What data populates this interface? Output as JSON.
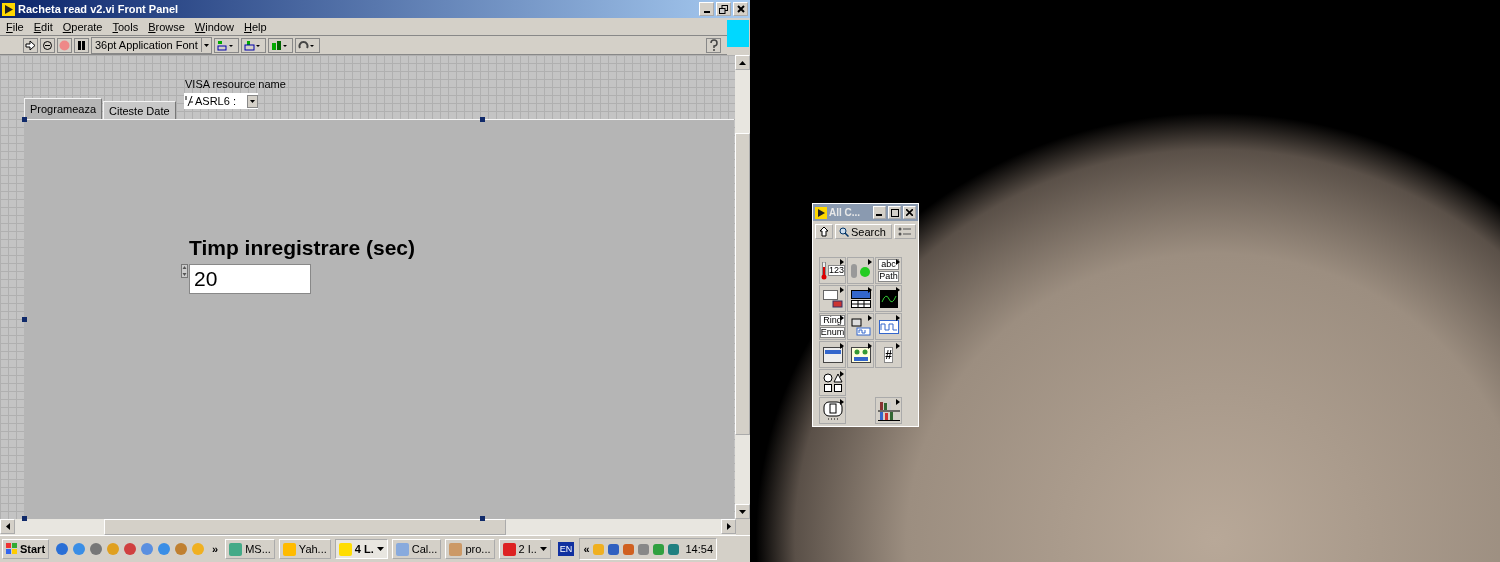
{
  "window": {
    "title": "Racheta read v2.vi Front Panel"
  },
  "menu": [
    "File",
    "Edit",
    "Operate",
    "Tools",
    "Browse",
    "Window",
    "Help"
  ],
  "toolbar": {
    "font": "36pt Application Font"
  },
  "panel": {
    "visa": {
      "label": "VISA resource name",
      "value": "ASRL6 :"
    },
    "tabs": [
      {
        "label": "Programeaza",
        "selected": true
      },
      {
        "label": "Citeste Date",
        "selected": false
      }
    ],
    "numeric": {
      "label": "Timp inregistrare (sec)",
      "value": "20"
    }
  },
  "taskbar": {
    "start": "Start",
    "more": "»",
    "tasks": [
      {
        "label": "MS...",
        "selected": false,
        "menu": false
      },
      {
        "label": "Yah...",
        "selected": false,
        "menu": false
      },
      {
        "label": "4 L.",
        "selected": true,
        "menu": true
      },
      {
        "label": "Cal...",
        "selected": false,
        "menu": false
      },
      {
        "label": "pro...",
        "selected": false,
        "menu": false
      },
      {
        "label": "2 I..",
        "selected": false,
        "menu": true
      }
    ],
    "language": "EN",
    "tray_toggle": "«",
    "clock": "14:54"
  },
  "palette": {
    "title": "All C...",
    "search": "Search",
    "items": [
      {
        "kind": "numeric",
        "texts": [
          "123"
        ]
      },
      {
        "kind": "boolean"
      },
      {
        "kind": "string",
        "texts": [
          "abc",
          "Path"
        ]
      },
      {
        "kind": "array"
      },
      {
        "kind": "table"
      },
      {
        "kind": "graph"
      },
      {
        "kind": "ring",
        "texts": [
          "Ring",
          "Enum"
        ]
      },
      {
        "kind": "io"
      },
      {
        "kind": "waveform"
      },
      {
        "kind": "container"
      },
      {
        "kind": "dialog"
      },
      {
        "kind": "refnum",
        "texts": [
          "#"
        ]
      },
      {
        "kind": "shapes"
      },
      {
        "kind": "document"
      },
      {
        "kind": "library"
      }
    ]
  }
}
